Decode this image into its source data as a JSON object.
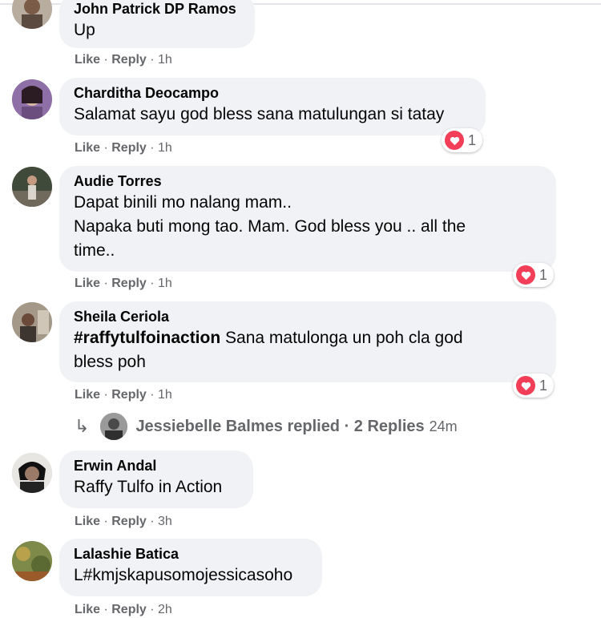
{
  "comments": [
    {
      "author": "John Patrick DP Ramos",
      "lines": [
        "Up"
      ],
      "actions": {
        "like": "Like",
        "reply": "Reply",
        "time": "1h"
      }
    },
    {
      "author": "Charditha Deocampo",
      "lines": [
        "Salamat sayu god bless sana matulungan si tatay"
      ],
      "actions": {
        "like": "Like",
        "reply": "Reply",
        "time": "1h"
      },
      "reaction": {
        "icon": "heart-icon",
        "count": "1"
      }
    },
    {
      "author": "Audie Torres",
      "lines": [
        "Dapat binili mo nalang mam..",
        "Napaka buti mong tao. Mam. God bless you .. all the",
        "time.."
      ],
      "actions": {
        "like": "Like",
        "reply": "Reply",
        "time": "1h"
      },
      "reaction": {
        "icon": "heart-icon",
        "count": "1"
      }
    },
    {
      "author": "Sheila Ceriola",
      "hashtag": "#raffytulfoinaction",
      "lines": [
        " Sana matulonga un poh cla god",
        "bless poh"
      ],
      "actions": {
        "like": "Like",
        "reply": "Reply",
        "time": "1h"
      },
      "reaction": {
        "icon": "heart-icon",
        "count": "1"
      },
      "replies": {
        "icon": "reply-arrow-icon",
        "text": "Jessiebelle Balmes replied · 2 Replies",
        "time": "24m"
      }
    },
    {
      "author": "Erwin Andal",
      "lines": [
        "Raffy Tulfo in Action"
      ],
      "actions": {
        "like": "Like",
        "reply": "Reply",
        "time": "3h"
      }
    },
    {
      "author": "Lalashie Batica",
      "lines": [
        "L#kmjskapusomojessicasoho"
      ],
      "actions": {
        "like": "Like",
        "reply": "Reply",
        "time": "2h"
      }
    }
  ],
  "separator": " · ",
  "colors": {
    "bubble": "#f0f2f5",
    "secondary_text": "#65676b",
    "love": "#f33e58"
  }
}
